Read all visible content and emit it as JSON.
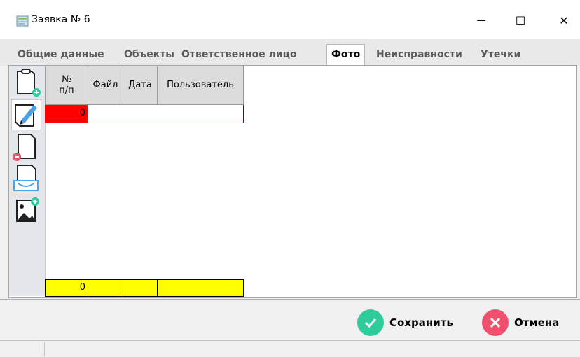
{
  "window": {
    "title": "Заявка № 6",
    "minimize": "—",
    "maximize": "☐",
    "close": "✕"
  },
  "tabs": [
    {
      "label": "Общие данные"
    },
    {
      "label": "Объекты"
    },
    {
      "label": "Ответственное лицо"
    },
    {
      "label": "Фото"
    },
    {
      "label": "Неисправности"
    },
    {
      "label": "Утечки"
    }
  ],
  "active_tab": "Фото",
  "toolbar": {
    "items": [
      {
        "icon": "add-document-icon"
      },
      {
        "icon": "edit-document-icon"
      },
      {
        "icon": "delete-document-icon"
      },
      {
        "icon": "open-document-icon"
      },
      {
        "icon": "add-image-icon"
      }
    ]
  },
  "grid": {
    "columns": [
      "№\nп/п",
      "Файл",
      "Дата",
      "Пользователь"
    ],
    "rows": [
      [
        "0",
        "",
        "",
        ""
      ]
    ],
    "footer": [
      "0",
      "",
      "",
      ""
    ],
    "colors": {
      "row_number_bg": "#ff0000",
      "footer_bg": "#ffff00",
      "header_bg": "#dcdcdc"
    }
  },
  "buttons": {
    "save": {
      "label": "Сохранить",
      "color": "#2ecc9a"
    },
    "cancel": {
      "label": "Отмена",
      "color": "#f0506e"
    }
  }
}
